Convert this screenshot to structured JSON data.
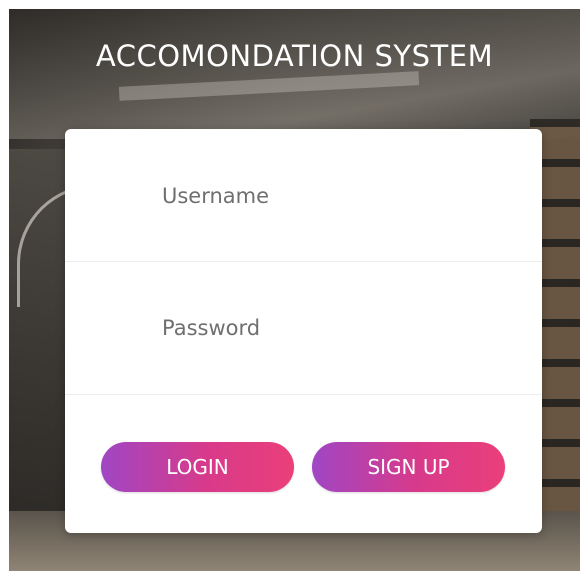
{
  "header": {
    "title": "ACCOMONDATION SYSTEM"
  },
  "login_form": {
    "username": {
      "placeholder": "Username",
      "value": ""
    },
    "password": {
      "placeholder": "Password",
      "value": ""
    },
    "login_label": "LOGIN",
    "signup_label": "SIGN UP"
  },
  "colors": {
    "button_gradient_start": "#a046c4",
    "button_gradient_end": "#ea3f7a",
    "card_background": "#ffffff",
    "title_color": "#ffffff"
  }
}
